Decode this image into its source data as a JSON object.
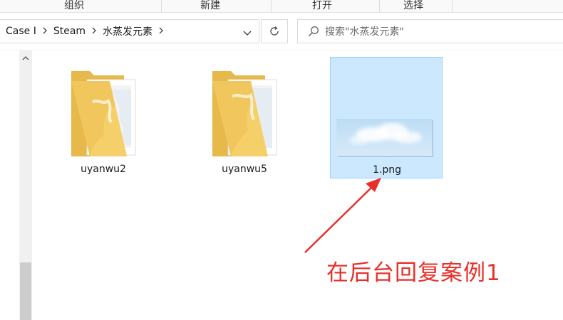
{
  "ribbon": {
    "groups": [
      "组织",
      "新建",
      "打开",
      "选择"
    ]
  },
  "address": {
    "crumbs": [
      "Case I",
      "Steam",
      "水蒸发元素"
    ]
  },
  "search": {
    "placeholder": "搜索\"水蒸发元素\""
  },
  "files": [
    {
      "name": "uyanwu2",
      "type": "folder",
      "selected": false
    },
    {
      "name": "uyanwu5",
      "type": "folder",
      "selected": false
    },
    {
      "name": "1.png",
      "type": "image",
      "selected": true
    }
  ],
  "annotation": {
    "text": "在后台回复案例1",
    "color": "#e8302a"
  },
  "colors": {
    "selection_bg": "#cce8ff",
    "selection_border": "#99d1ff",
    "folder": "#f5cf6a",
    "folder_dark": "#e7b84a"
  },
  "icons": [
    "chevron-right-icon",
    "chevron-down-icon",
    "refresh-icon",
    "search-icon",
    "scroll-up-arrow-icon",
    "folder-icon",
    "image-thumbnail-icon",
    "arrow-icon"
  ]
}
